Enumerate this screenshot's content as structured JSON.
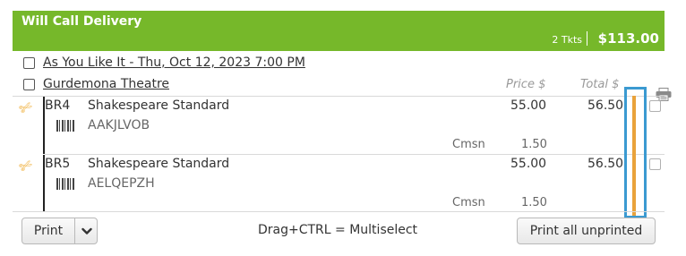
{
  "header": {
    "title": "Will Call Delivery",
    "tickets_count": "2 Tkts",
    "total": "$113.00"
  },
  "event": {
    "name": "As You Like It - Thu, Oct 12, 2023 7:00 PM",
    "venue": "Gurdemona Theatre"
  },
  "columns": {
    "price": "Price $",
    "total": "Total $"
  },
  "tickets": [
    {
      "seat": "BR4",
      "price_level": "Shakespeare Standard",
      "barcode": "AAKJLVOB",
      "price": "55.00",
      "total": "56.50",
      "commission_label": "Cmsn",
      "commission": "1.50"
    },
    {
      "seat": "BR5",
      "price_level": "Shakespeare Standard",
      "barcode": "AELQEPZH",
      "price": "55.00",
      "total": "56.50",
      "commission_label": "Cmsn",
      "commission": "1.50"
    }
  ],
  "footer": {
    "print_label": "Print",
    "hint": "Drag+CTRL = Multiselect",
    "print_all_label": "Print all unprinted"
  },
  "icons": {
    "ticket": "ticket-icon",
    "barcode": "barcode-icon",
    "printer": "printer-icon",
    "dropdown": "chevron-down-icon"
  },
  "colors": {
    "header_bg": "#76b82a",
    "ticket_icon": "#f0b242",
    "highlight_bar": "#e9a23b",
    "selection_box": "#3b9ad1"
  }
}
